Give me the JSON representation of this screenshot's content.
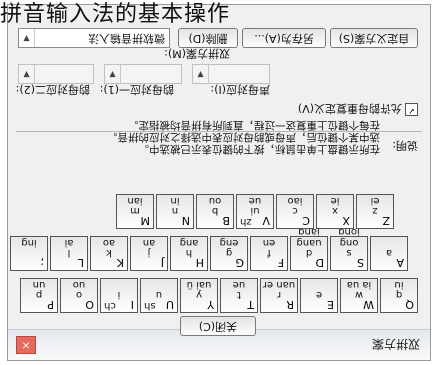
{
  "page_title": "拼音输入法的基本操作",
  "dialog": {
    "title": "双拼方案",
    "close_x": "×",
    "scheme_label": "双拼方案(M):",
    "scheme_value": "微软拼音输入法",
    "btn_custom": "自定义方案(S)",
    "btn_saveas": "另存为(A)...",
    "btn_delete": "删除(D)",
    "group_init_label": "声母对应(I):",
    "group_final1_label": "韵母对应一(1):",
    "group_final2_label": "韵母对应二(2):",
    "checkbox_label": "允许韵母重复定义(V)",
    "checkbox_checked": "✓",
    "note_label": "说明:",
    "note_line1": "在所示键盘上单击鼠标，按下的键位表示已被选中。",
    "note_line2": "选中某个键位后，声母或韵母对应表中选择之对应的拼音。",
    "note_line3": "在每个键位上重复这一过程，直到所有拼音均被指定。",
    "close_button": "关闭(C)"
  },
  "keyboard": {
    "rows": [
      [
        {
          "key": "Q",
          "c": "",
          "s1": "q",
          "s2": "iu"
        },
        {
          "key": "W",
          "c": "",
          "s1": "w",
          "s2": "ia ua"
        },
        {
          "key": "E",
          "c": "",
          "s1": "e",
          "s2": ""
        },
        {
          "key": "R",
          "c": "",
          "s1": "r",
          "s2": "uan er"
        },
        {
          "key": "T",
          "c": "",
          "s1": "t",
          "s2": "ue"
        },
        {
          "key": "Y",
          "c": "",
          "s1": "y",
          "s2": "uai ü"
        },
        {
          "key": "U",
          "c": "sh",
          "s1": "u",
          "s2": ""
        },
        {
          "key": "I",
          "c": "ch",
          "s1": "i",
          "s2": ""
        },
        {
          "key": "O",
          "c": "",
          "s1": "o",
          "s2": "uo"
        },
        {
          "key": "P",
          "c": "",
          "s1": "p",
          "s2": "un"
        }
      ],
      [
        {
          "key": "A",
          "c": "",
          "s1": "a",
          "s2": ""
        },
        {
          "key": "S",
          "c": "",
          "s1": "s",
          "s2": "ong iong"
        },
        {
          "key": "D",
          "c": "",
          "s1": "d",
          "s2": "uang iang"
        },
        {
          "key": "F",
          "c": "",
          "s1": "f",
          "s2": "en"
        },
        {
          "key": "G",
          "c": "",
          "s1": "g",
          "s2": "eng"
        },
        {
          "key": "H",
          "c": "",
          "s1": "h",
          "s2": "ang"
        },
        {
          "key": "J",
          "c": "",
          "s1": "j",
          "s2": "an"
        },
        {
          "key": "K",
          "c": "",
          "s1": "k",
          "s2": "ao"
        },
        {
          "key": "L",
          "c": "",
          "s1": "l",
          "s2": "ai"
        },
        {
          "key": ";",
          "c": "",
          "s1": "",
          "s2": "ing"
        }
      ],
      [
        {
          "key": "Z",
          "c": "",
          "s1": "z",
          "s2": "ei"
        },
        {
          "key": "X",
          "c": "",
          "s1": "x",
          "s2": "ie"
        },
        {
          "key": "C",
          "c": "",
          "s1": "c",
          "s2": "iao"
        },
        {
          "key": "V",
          "c": "zh",
          "s1": "ui",
          "s2": "ue"
        },
        {
          "key": "B",
          "c": "",
          "s1": "b",
          "s2": "ou"
        },
        {
          "key": "N",
          "c": "",
          "s1": "n",
          "s2": "in"
        },
        {
          "key": "M",
          "c": "",
          "s1": "m",
          "s2": "ian"
        }
      ]
    ]
  }
}
